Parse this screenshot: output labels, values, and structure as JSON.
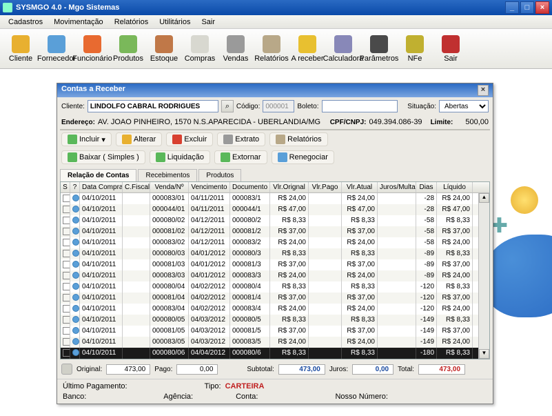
{
  "window": {
    "title": "SYSMGO 4.0 - Mgo Sistemas"
  },
  "menu": [
    "Cadastros",
    "Movimentação",
    "Relatórios",
    "Utilitários",
    "Sair"
  ],
  "toolbar": [
    {
      "label": "Cliente",
      "color": "#e8b030"
    },
    {
      "label": "Fornecedor",
      "color": "#5a9fd8"
    },
    {
      "label": "Funcionário",
      "color": "#e86a30"
    },
    {
      "label": "Produtos",
      "color": "#7ab85a"
    },
    {
      "label": "Estoque",
      "color": "#c07848"
    },
    {
      "label": "Compras",
      "color": "#d8d8d0"
    },
    {
      "label": "Vendas",
      "color": "#9a9a9a"
    },
    {
      "label": "Relatórios",
      "color": "#b8a888"
    },
    {
      "label": "A receber",
      "color": "#e8c030"
    },
    {
      "label": "Calculadora",
      "color": "#8888b8"
    },
    {
      "label": "Parâmetros",
      "color": "#4a4a4a"
    },
    {
      "label": "NFe",
      "color": "#c0b030"
    },
    {
      "label": "Sair",
      "color": "#c03030"
    }
  ],
  "dialog": {
    "title": "Contas a Receber",
    "labels": {
      "cliente": "Cliente:",
      "codigo": "Código:",
      "boleto": "Boleto:",
      "situacao": "Situação:",
      "endereco": "Endereço:",
      "cpfcnpj": "CPF/CNPJ:",
      "limite": "Limite:"
    },
    "values": {
      "cliente": "LINDOLFO CABRAL RODRIGUES",
      "codigo": "000001",
      "boleto": "",
      "situacao": "Abertas",
      "endereco": "AV. JOAO PINHEIRO, 1570  N.S.APARECIDA - UBERLANDIA/MG",
      "cpfcnpj": "049.394.086-39",
      "limite": "500,00"
    },
    "actions": {
      "incluir": "Incluir",
      "alterar": "Alterar",
      "excluir": "Excluir",
      "extrato": "Extrato",
      "relatorios": "Relatórios",
      "baixar": "Baixar ( Simples )",
      "liquidacao": "Liquidação",
      "extornar": "Extornar",
      "renegociar": "Renegociar"
    },
    "tabs": [
      "Relação de Contas",
      "Recebimentos",
      "Produtos"
    ],
    "columns": [
      "S",
      "?",
      "Data Compra",
      "C.Fiscal",
      "Venda/Nº",
      "Vencimento",
      "Documento",
      "Vlr.Orignal",
      "Vlr.Pago",
      "Vlr.Atual",
      "Juros/Multa",
      "Dias",
      "Líquido"
    ],
    "rows": [
      {
        "data": "04/10/2011",
        "venda": "000083/01",
        "venc": "04/11/2011",
        "doc": "000083/1",
        "orig": "R$ 24,00",
        "pago": "",
        "atual": "R$ 24,00",
        "jm": "",
        "dias": "-28",
        "liq": "R$ 24,00"
      },
      {
        "data": "04/10/2011",
        "venda": "000044/01",
        "venc": "04/11/2011",
        "doc": "000044/1",
        "orig": "R$ 47,00",
        "pago": "",
        "atual": "R$ 47,00",
        "jm": "",
        "dias": "-28",
        "liq": "R$ 47,00"
      },
      {
        "data": "04/10/2011",
        "venda": "000080/02",
        "venc": "04/12/2011",
        "doc": "000080/2",
        "orig": "R$ 8,33",
        "pago": "",
        "atual": "R$ 8,33",
        "jm": "",
        "dias": "-58",
        "liq": "R$ 8,33"
      },
      {
        "data": "04/10/2011",
        "venda": "000081/02",
        "venc": "04/12/2011",
        "doc": "000081/2",
        "orig": "R$ 37,00",
        "pago": "",
        "atual": "R$ 37,00",
        "jm": "",
        "dias": "-58",
        "liq": "R$ 37,00"
      },
      {
        "data": "04/10/2011",
        "venda": "000083/02",
        "venc": "04/12/2011",
        "doc": "000083/2",
        "orig": "R$ 24,00",
        "pago": "",
        "atual": "R$ 24,00",
        "jm": "",
        "dias": "-58",
        "liq": "R$ 24,00"
      },
      {
        "data": "04/10/2011",
        "venda": "000080/03",
        "venc": "04/01/2012",
        "doc": "000080/3",
        "orig": "R$ 8,33",
        "pago": "",
        "atual": "R$ 8,33",
        "jm": "",
        "dias": "-89",
        "liq": "R$ 8,33"
      },
      {
        "data": "04/10/2011",
        "venda": "000081/03",
        "venc": "04/01/2012",
        "doc": "000081/3",
        "orig": "R$ 37,00",
        "pago": "",
        "atual": "R$ 37,00",
        "jm": "",
        "dias": "-89",
        "liq": "R$ 37,00"
      },
      {
        "data": "04/10/2011",
        "venda": "000083/03",
        "venc": "04/01/2012",
        "doc": "000083/3",
        "orig": "R$ 24,00",
        "pago": "",
        "atual": "R$ 24,00",
        "jm": "",
        "dias": "-89",
        "liq": "R$ 24,00"
      },
      {
        "data": "04/10/2011",
        "venda": "000080/04",
        "venc": "04/02/2012",
        "doc": "000080/4",
        "orig": "R$ 8,33",
        "pago": "",
        "atual": "R$ 8,33",
        "jm": "",
        "dias": "-120",
        "liq": "R$ 8,33"
      },
      {
        "data": "04/10/2011",
        "venda": "000081/04",
        "venc": "04/02/2012",
        "doc": "000081/4",
        "orig": "R$ 37,00",
        "pago": "",
        "atual": "R$ 37,00",
        "jm": "",
        "dias": "-120",
        "liq": "R$ 37,00"
      },
      {
        "data": "04/10/2011",
        "venda": "000083/04",
        "venc": "04/02/2012",
        "doc": "000083/4",
        "orig": "R$ 24,00",
        "pago": "",
        "atual": "R$ 24,00",
        "jm": "",
        "dias": "-120",
        "liq": "R$ 24,00"
      },
      {
        "data": "04/10/2011",
        "venda": "000080/05",
        "venc": "04/03/2012",
        "doc": "000080/5",
        "orig": "R$ 8,33",
        "pago": "",
        "atual": "R$ 8,33",
        "jm": "",
        "dias": "-149",
        "liq": "R$ 8,33"
      },
      {
        "data": "04/10/2011",
        "venda": "000081/05",
        "venc": "04/03/2012",
        "doc": "000081/5",
        "orig": "R$ 37,00",
        "pago": "",
        "atual": "R$ 37,00",
        "jm": "",
        "dias": "-149",
        "liq": "R$ 37,00"
      },
      {
        "data": "04/10/2011",
        "venda": "000083/05",
        "venc": "04/03/2012",
        "doc": "000083/5",
        "orig": "R$ 24,00",
        "pago": "",
        "atual": "R$ 24,00",
        "jm": "",
        "dias": "-149",
        "liq": "R$ 24,00"
      },
      {
        "data": "04/10/2011",
        "venda": "000080/06",
        "venc": "04/04/2012",
        "doc": "000080/6",
        "orig": "R$ 8,33",
        "pago": "",
        "atual": "R$ 8,33",
        "jm": "",
        "dias": "-180",
        "liq": "R$ 8,33",
        "sel": true
      }
    ],
    "totals": {
      "original_lbl": "Original:",
      "original": "473,00",
      "pago_lbl": "Pago:",
      "pago": "0,00",
      "subtotal_lbl": "Subtotal:",
      "subtotal": "473,00",
      "juros_lbl": "Juros:",
      "juros": "0,00",
      "total_lbl": "Total:",
      "total": "473,00"
    },
    "footer": {
      "ultimo": "Último Pagamento:",
      "tipo_lbl": "Tipo:",
      "tipo": "CARTEIRA",
      "banco": "Banco:",
      "agencia": "Agência:",
      "conta": "Conta:",
      "nosso": "Nosso Número:"
    }
  }
}
